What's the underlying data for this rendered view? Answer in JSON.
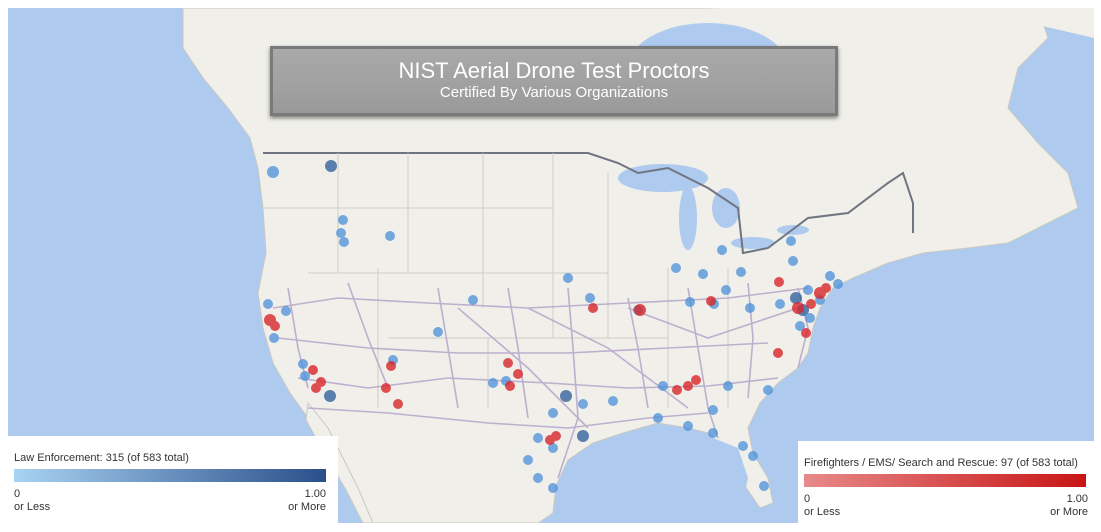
{
  "title": {
    "main": "NIST Aerial Drone Test Proctors",
    "sub": "Certified By Various Organizations"
  },
  "legend_law": {
    "title": "Law Enforcement: 315 (of 583 total)",
    "min_value": "0",
    "min_label": "or Less",
    "max_value": "1.00",
    "max_label": "or More",
    "color_low": "#a9d3f2",
    "color_high": "#2a4f8b"
  },
  "legend_fire": {
    "title": "Firefighters / EMS/ Search and Rescue: 97 (of 583 total)",
    "min_value": "0",
    "min_label": "or Less",
    "max_value": "1.00",
    "max_label": "or More",
    "color_low": "#e88a8a",
    "color_high": "#c81515"
  },
  "colors": {
    "water": "#aecbef",
    "land": "#f0efe9",
    "border": "#6f7580",
    "road": "#b8a9cc"
  }
}
